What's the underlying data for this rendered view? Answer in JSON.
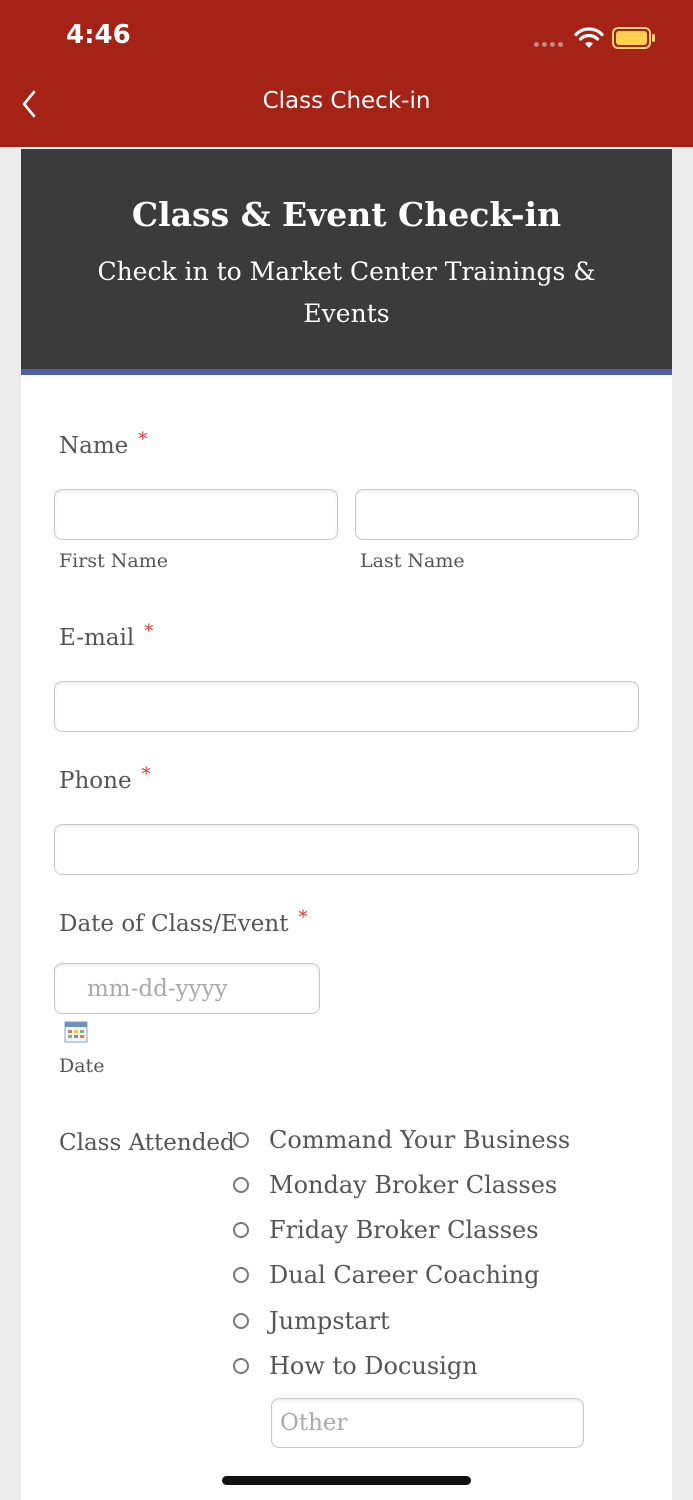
{
  "status_bar": {
    "time": "4:46"
  },
  "nav": {
    "title": "Class Check-in",
    "back_icon": "chevron-left-icon"
  },
  "header": {
    "title": "Class & Event Check-in",
    "subtitle": "Check in to Market Center Trainings & Events"
  },
  "form": {
    "name": {
      "label": "Name",
      "required_mark": "*",
      "first_sublabel": "First Name",
      "last_sublabel": "Last Name",
      "first_value": "",
      "last_value": ""
    },
    "email": {
      "label": "E-mail",
      "required_mark": "*",
      "value": ""
    },
    "phone": {
      "label": "Phone",
      "required_mark": "*",
      "value": ""
    },
    "date": {
      "label": "Date of Class/Event",
      "required_mark": "*",
      "placeholder": "mm-dd-yyyy",
      "sublabel": "Date",
      "icon": "calendar-icon"
    },
    "class_attended": {
      "label": "Class Attended",
      "options": [
        "Command Your Business",
        "Monday Broker Classes",
        "Friday Broker Classes",
        "Dual Career Coaching",
        "Jumpstart",
        "How to Docusign"
      ],
      "other_placeholder": "Other"
    }
  },
  "colors": {
    "brand_red": "#a52217",
    "header_bg": "#3b3b3b",
    "header_accent": "#4c5ea8",
    "required": "#d33a2c"
  }
}
